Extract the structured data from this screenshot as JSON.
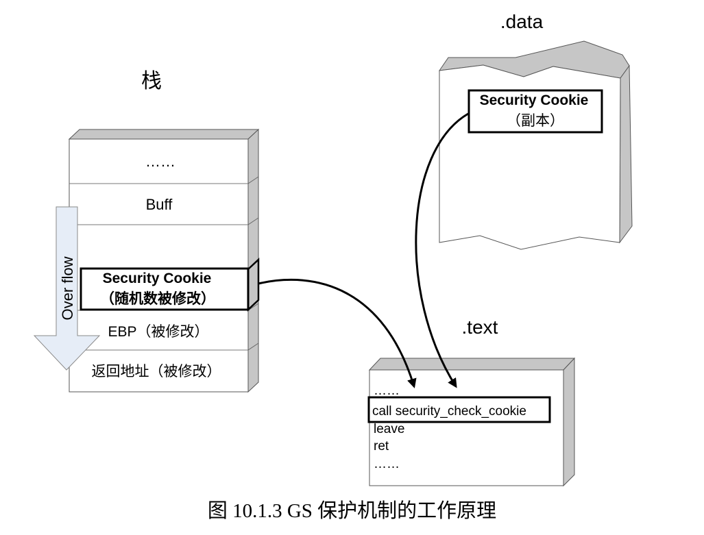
{
  "stack": {
    "title": "栈",
    "cells": [
      "……",
      "Buff",
      ""
    ],
    "cookie": {
      "line1": "Security Cookie",
      "line2": "（随机数被修改）"
    },
    "ebp": "EBP（被修改）",
    "ret": "返回地址（被修改）",
    "overflow_label": "Over flow"
  },
  "data_section": {
    "title": ".data",
    "cookie": {
      "line1": "Security Cookie",
      "line2": "（副本）"
    }
  },
  "text_section": {
    "title": ".text",
    "lines": [
      "……",
      "call security_check_cookie",
      "leave",
      "ret",
      "……"
    ]
  },
  "caption": "图 10.1.3  GS   保护机制的工作原理",
  "colors": {
    "box_side": "#c6c6c6",
    "arrow_fill": "#e6edf7",
    "line": "#000000"
  }
}
